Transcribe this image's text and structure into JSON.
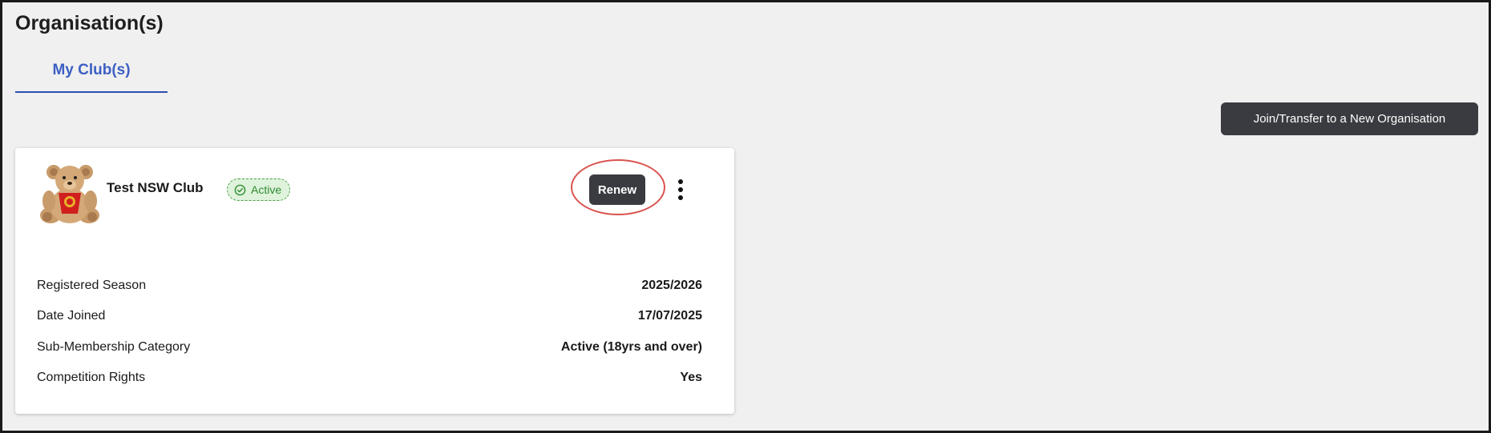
{
  "page": {
    "title": "Organisation(s)"
  },
  "tabs": [
    {
      "label": "My Club(s)",
      "active": true
    }
  ],
  "actions": {
    "join_label": "Join/Transfer to a New Organisation"
  },
  "club_card": {
    "name": "Test NSW Club",
    "status": "Active",
    "status_icon": "check-circle-icon",
    "logo": "teddy-bear-mascot",
    "renew_label": "Renew",
    "more_icon": "more-vertical-icon",
    "details": [
      {
        "label": "Registered Season",
        "value": "2025/2026"
      },
      {
        "label": "Date Joined",
        "value": "17/07/2025"
      },
      {
        "label": "Sub-Membership Category",
        "value": "Active (18yrs and over)"
      },
      {
        "label": "Competition Rights",
        "value": "Yes"
      }
    ]
  },
  "colors": {
    "accent_blue": "#3d5fc4",
    "button_dark": "#3a3b40",
    "status_green": "#2e8b2e",
    "status_bg": "#dff3dc",
    "highlight_red": "#d9534f"
  }
}
